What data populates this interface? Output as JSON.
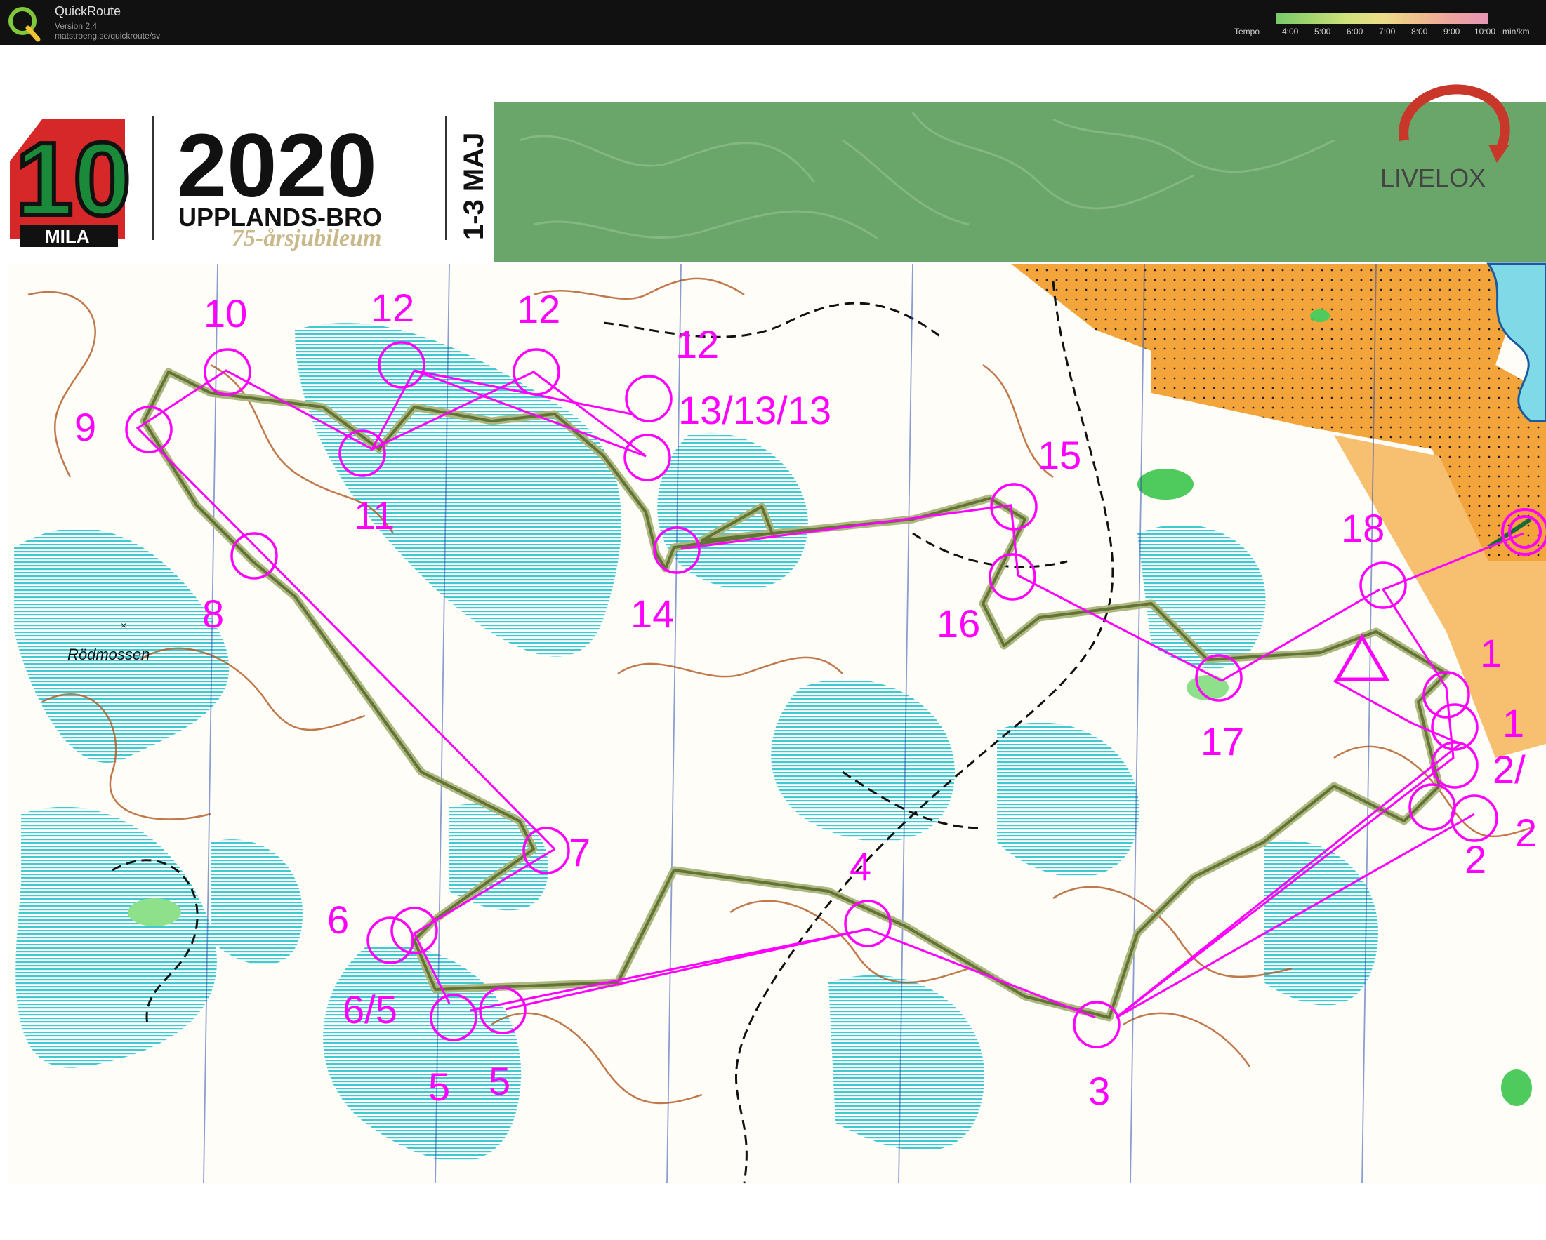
{
  "app": {
    "name": "QuickRoute",
    "version": "Version 2.4",
    "url": "matstroeng.se/quickroute/sv"
  },
  "tempo_legend": {
    "label": "Tempo",
    "ticks": [
      "4:00",
      "5:00",
      "6:00",
      "7:00",
      "8:00",
      "9:00",
      "10:00"
    ],
    "unit": "min/km"
  },
  "header": {
    "logo_number": "10",
    "logo_text": "MILA",
    "year": "2020",
    "place": "UPPLANDS-BRO",
    "jubilee": "75-årsjubileum",
    "dates": "1-3 MAJ",
    "brand": "LIVELOX"
  },
  "map": {
    "place_name": "Rödmossen",
    "colors": {
      "course": "#ff00ff",
      "route": "#6f7f3d",
      "open_land": "#f3a43a",
      "marsh": "#38c8c8",
      "green": "#4fca5c",
      "contour": "#b2561f"
    },
    "controls": [
      {
        "id": "c1a",
        "label": "1"
      },
      {
        "id": "c1b",
        "label": "1"
      },
      {
        "id": "c2a",
        "label": "2/"
      },
      {
        "id": "c2b",
        "label": "2"
      },
      {
        "id": "c2c",
        "label": "2"
      },
      {
        "id": "c3",
        "label": "3"
      },
      {
        "id": "c4",
        "label": "4"
      },
      {
        "id": "c5a",
        "label": "5"
      },
      {
        "id": "c5b",
        "label": "5"
      },
      {
        "id": "c6a",
        "label": "6"
      },
      {
        "id": "c6b",
        "label": "6/5"
      },
      {
        "id": "c7",
        "label": "7"
      },
      {
        "id": "c8",
        "label": "8"
      },
      {
        "id": "c9",
        "label": "9"
      },
      {
        "id": "c10",
        "label": "10"
      },
      {
        "id": "c11",
        "label": "11"
      },
      {
        "id": "c12a",
        "label": "12"
      },
      {
        "id": "c12b",
        "label": "12"
      },
      {
        "id": "c12c",
        "label": "12"
      },
      {
        "id": "c13",
        "label": "13/13/13"
      },
      {
        "id": "c14",
        "label": "14"
      },
      {
        "id": "c15",
        "label": "15"
      },
      {
        "id": "c16",
        "label": "16"
      },
      {
        "id": "c17",
        "label": "17"
      },
      {
        "id": "c18",
        "label": "18"
      }
    ]
  }
}
